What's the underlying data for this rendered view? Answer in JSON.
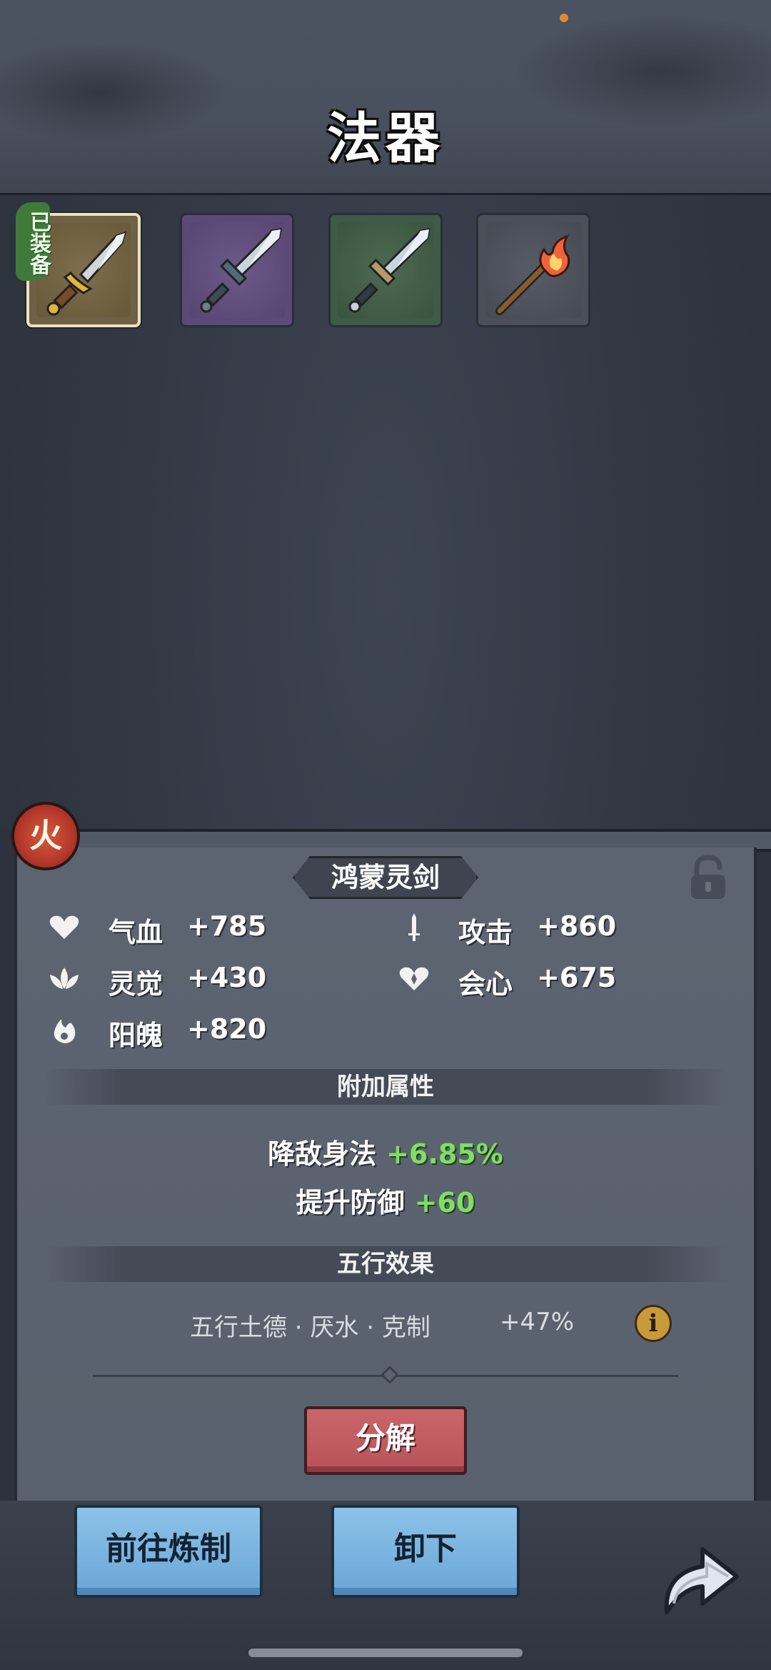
{
  "header": {
    "title": "法器"
  },
  "inventory": {
    "equipped_tag": "已装备",
    "slots": [
      {
        "name": "golden-sword",
        "rarity_color": "#6f6146",
        "equipped": true
      },
      {
        "name": "purple-sword",
        "rarity_color": "#5b4a77",
        "equipped": false
      },
      {
        "name": "green-sword",
        "rarity_color": "#3f5a46",
        "equipped": false
      },
      {
        "name": "fire-torch",
        "rarity_color": "#4a4f58",
        "equipped": false
      }
    ]
  },
  "detail": {
    "element": "火",
    "item_name": "鸿蒙灵剑",
    "stats": [
      {
        "icon": "heart-icon",
        "label": "气血",
        "value": "+785"
      },
      {
        "icon": "dagger-icon",
        "label": "攻击",
        "value": "+860"
      },
      {
        "icon": "lotus-icon",
        "label": "灵觉",
        "value": "+430"
      },
      {
        "icon": "crit-heart-icon",
        "label": "会心",
        "value": "+675"
      },
      {
        "icon": "flame-icon",
        "label": "阳魄",
        "value": "+820"
      }
    ],
    "extra_title": "附加属性",
    "extra": [
      {
        "label": "降敌身法",
        "value": "+6.85%"
      },
      {
        "label": "提升防御",
        "value": "+60"
      }
    ],
    "wuxing_title": "五行效果",
    "wuxing": {
      "text": "五行土德 · 厌水 · 克制",
      "value": "+47%"
    },
    "dismantle_label": "分解"
  },
  "bottom": {
    "forge_label": "前往炼制",
    "unequip_label": "卸下"
  },
  "colors": {
    "accent_green": "#7de060",
    "button_blue": "#7bb4e0",
    "button_red": "#c05c62",
    "element_red": "#b3382a"
  }
}
